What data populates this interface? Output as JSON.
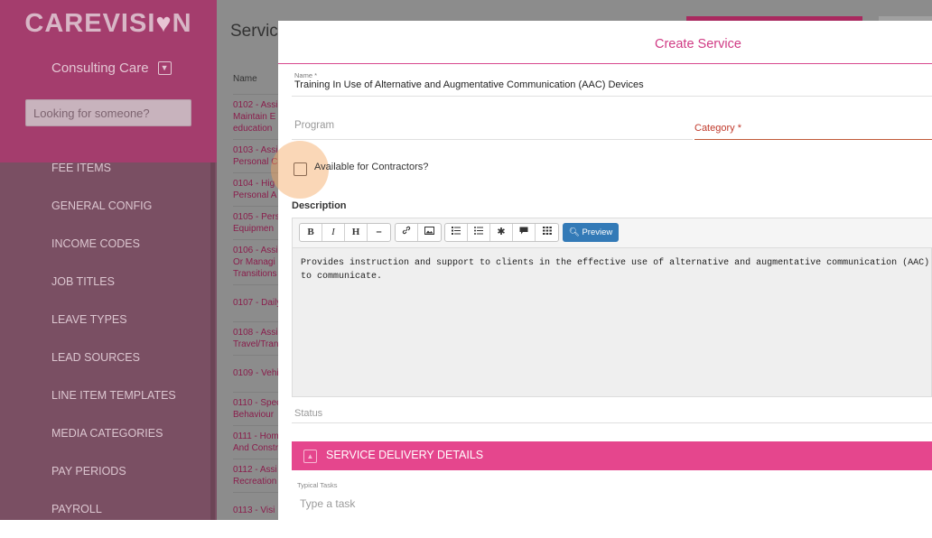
{
  "app": {
    "logo_part1": "CAREVISI",
    "logo_heart": "♥",
    "logo_part2": "N",
    "org_name": "Consulting Care",
    "search_placeholder": "Looking for someone?"
  },
  "sidebar": {
    "items": [
      {
        "label": "FEE ITEMS"
      },
      {
        "label": "GENERAL CONFIG"
      },
      {
        "label": "INCOME CODES"
      },
      {
        "label": "JOB TITLES"
      },
      {
        "label": "LEAVE TYPES"
      },
      {
        "label": "LEAD SOURCES"
      },
      {
        "label": "LINE ITEM TEMPLATES"
      },
      {
        "label": "MEDIA CATEGORIES"
      },
      {
        "label": "PAY PERIODS"
      },
      {
        "label": "PAYROLL"
      }
    ]
  },
  "background_page": {
    "title": "Service",
    "column_header": "Name",
    "rows": [
      {
        "line1": "0102 - Assi",
        "line2": "Maintain E",
        "line3": "education"
      },
      {
        "line1": "0103 - Assi",
        "line2": "Personal C",
        "line3": ""
      },
      {
        "line1": "0104 - Hig",
        "line2": "Personal A",
        "line3": ""
      },
      {
        "line1": "0105 - Pers",
        "line2": "Equipmen",
        "line3": ""
      },
      {
        "line1": "0106 - Assi",
        "line2": "Or Managi",
        "line3": "Transitions"
      },
      {
        "line1": "0107 - Daily",
        "line2": "",
        "line3": ""
      },
      {
        "line1": "0108 - Assi",
        "line2": "Travel/Tran",
        "line3": ""
      },
      {
        "line1": "0109 - Vehi",
        "line2": "",
        "line3": ""
      },
      {
        "line1": "0110 - Spec",
        "line2": "Behaviour",
        "line3": ""
      },
      {
        "line1": "0111 - Hom",
        "line2": "And Constr",
        "line3": ""
      },
      {
        "line1": "0112 - Assi",
        "line2": "Recreation",
        "line3": ""
      },
      {
        "line1": "0113 - Visi",
        "line2": "",
        "line3": ""
      }
    ]
  },
  "modal": {
    "title": "Create Service",
    "name_label": "Name *",
    "name_value": "Training In Use of Alternative and Augmentative Communication (AAC) Devices",
    "program_label": "Program",
    "category_label": "Category *",
    "contractors_label": "Available for Contractors?",
    "contractors_checked": false,
    "description_label": "Description",
    "toolbar": {
      "bold": "B",
      "italic": "I",
      "heading": "H",
      "hr": "–",
      "preview_label": "Preview"
    },
    "description_text": "Provides instruction and support to clients in the effective use of alternative and augmentative communication (AAC) devic\nto communicate.",
    "status_label": "Status",
    "section_title": "SERVICE DELIVERY DETAILS",
    "tasks_label": "Typical Tasks",
    "tasks_placeholder": "Type a task"
  },
  "colors": {
    "brand": "#a43d6d",
    "accent": "#e5468d",
    "preview_button": "#337ab7"
  }
}
